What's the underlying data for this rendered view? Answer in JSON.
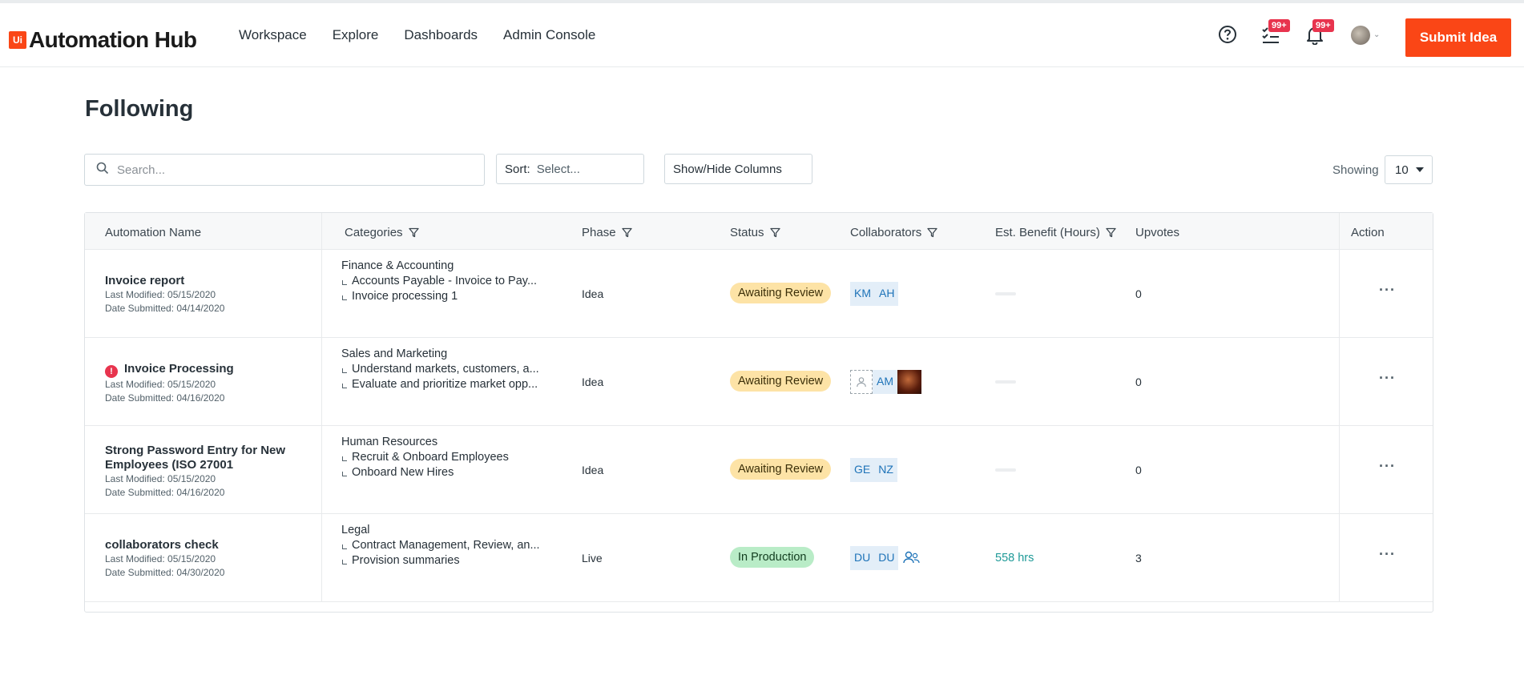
{
  "header": {
    "logo_mark": "Ui",
    "logo_text": "Automation Hub",
    "nav": [
      "Workspace",
      "Explore",
      "Dashboards",
      "Admin Console"
    ],
    "tasks_badge": "99+",
    "notifications_badge": "99+",
    "submit_label": "Submit Idea"
  },
  "page": {
    "title": "Following",
    "search_placeholder": "Search...",
    "sort_label": "Sort:",
    "sort_value": "Select...",
    "columns_label": "Show/Hide Columns",
    "showing_label": "Showing",
    "showing_value": "10"
  },
  "table": {
    "headers": {
      "name": "Automation Name",
      "categories": "Categories",
      "phase": "Phase",
      "status": "Status",
      "collaborators": "Collaborators",
      "benefit": "Est. Benefit (Hours)",
      "upvotes": "Upvotes",
      "action": "Action"
    },
    "rows": [
      {
        "name": "Invoice report",
        "last_modified": "Last Modified: 05/15/2020",
        "date_submitted": "Date Submitted: 04/14/2020",
        "category": "Finance & Accounting",
        "sub1": "Accounts Payable - Invoice to Pay...",
        "sub2": "Invoice processing 1",
        "phase": "Idea",
        "status": "Awaiting Review",
        "collab1": "KM",
        "collab2": "AH",
        "benefit": "",
        "upvotes": "0",
        "action": "···"
      },
      {
        "name": "Invoice Processing",
        "last_modified": "Last Modified: 05/15/2020",
        "date_submitted": "Date Submitted: 04/16/2020",
        "category": "Sales and Marketing",
        "sub1": "Understand markets, customers, a...",
        "sub2": "Evaluate and prioritize market opp...",
        "phase": "Idea",
        "status": "Awaiting Review",
        "collab1": "AM",
        "benefit": "",
        "upvotes": "0",
        "action": "···"
      },
      {
        "name": "Strong Password Entry for New Employees (ISO 27001",
        "last_modified": "Last Modified: 05/15/2020",
        "date_submitted": "Date Submitted: 04/16/2020",
        "category": "Human Resources",
        "sub1": "Recruit & Onboard Employees",
        "sub2": "Onboard New Hires",
        "phase": "Idea",
        "status": "Awaiting Review",
        "collab1": "GE",
        "collab2": "NZ",
        "benefit": "",
        "upvotes": "0",
        "action": "···"
      },
      {
        "name": "collaborators check",
        "last_modified": "Last Modified: 05/15/2020",
        "date_submitted": "Date Submitted: 04/30/2020",
        "category": "Legal",
        "sub1": "Contract Management, Review, an...",
        "sub2": "Provision summaries",
        "phase": "Live",
        "status": "In Production",
        "collab1": "DU",
        "collab2": "DU",
        "benefit": "558 hrs",
        "upvotes": "3",
        "action": "···"
      }
    ]
  },
  "colors": {
    "brand": "#fa4616",
    "badge": "#e8344e",
    "awaiting_review": "#fde3a6",
    "in_production": "#b9ecc7",
    "benefit_text": "#1f9a98"
  }
}
